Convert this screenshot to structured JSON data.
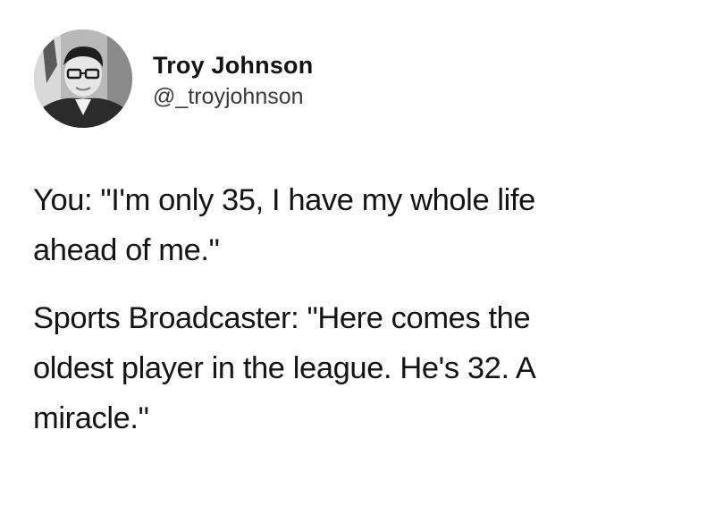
{
  "tweet": {
    "author": {
      "display_name": "Troy Johnson",
      "handle": "@_troyjohnson",
      "avatar_icon": "user-photo-avatar"
    },
    "paragraphs": [
      {
        "lines": [
          "You: \"I'm only 35, I have my whole life",
          "ahead of me.\""
        ]
      },
      {
        "lines": [
          "Sports Broadcaster: \"Here comes the",
          "oldest player in the league. He's 32. A",
          "miracle.\""
        ]
      }
    ]
  },
  "colors": {
    "background": "#ffffff",
    "text": "#141414",
    "handle": "#3a3a3a"
  }
}
